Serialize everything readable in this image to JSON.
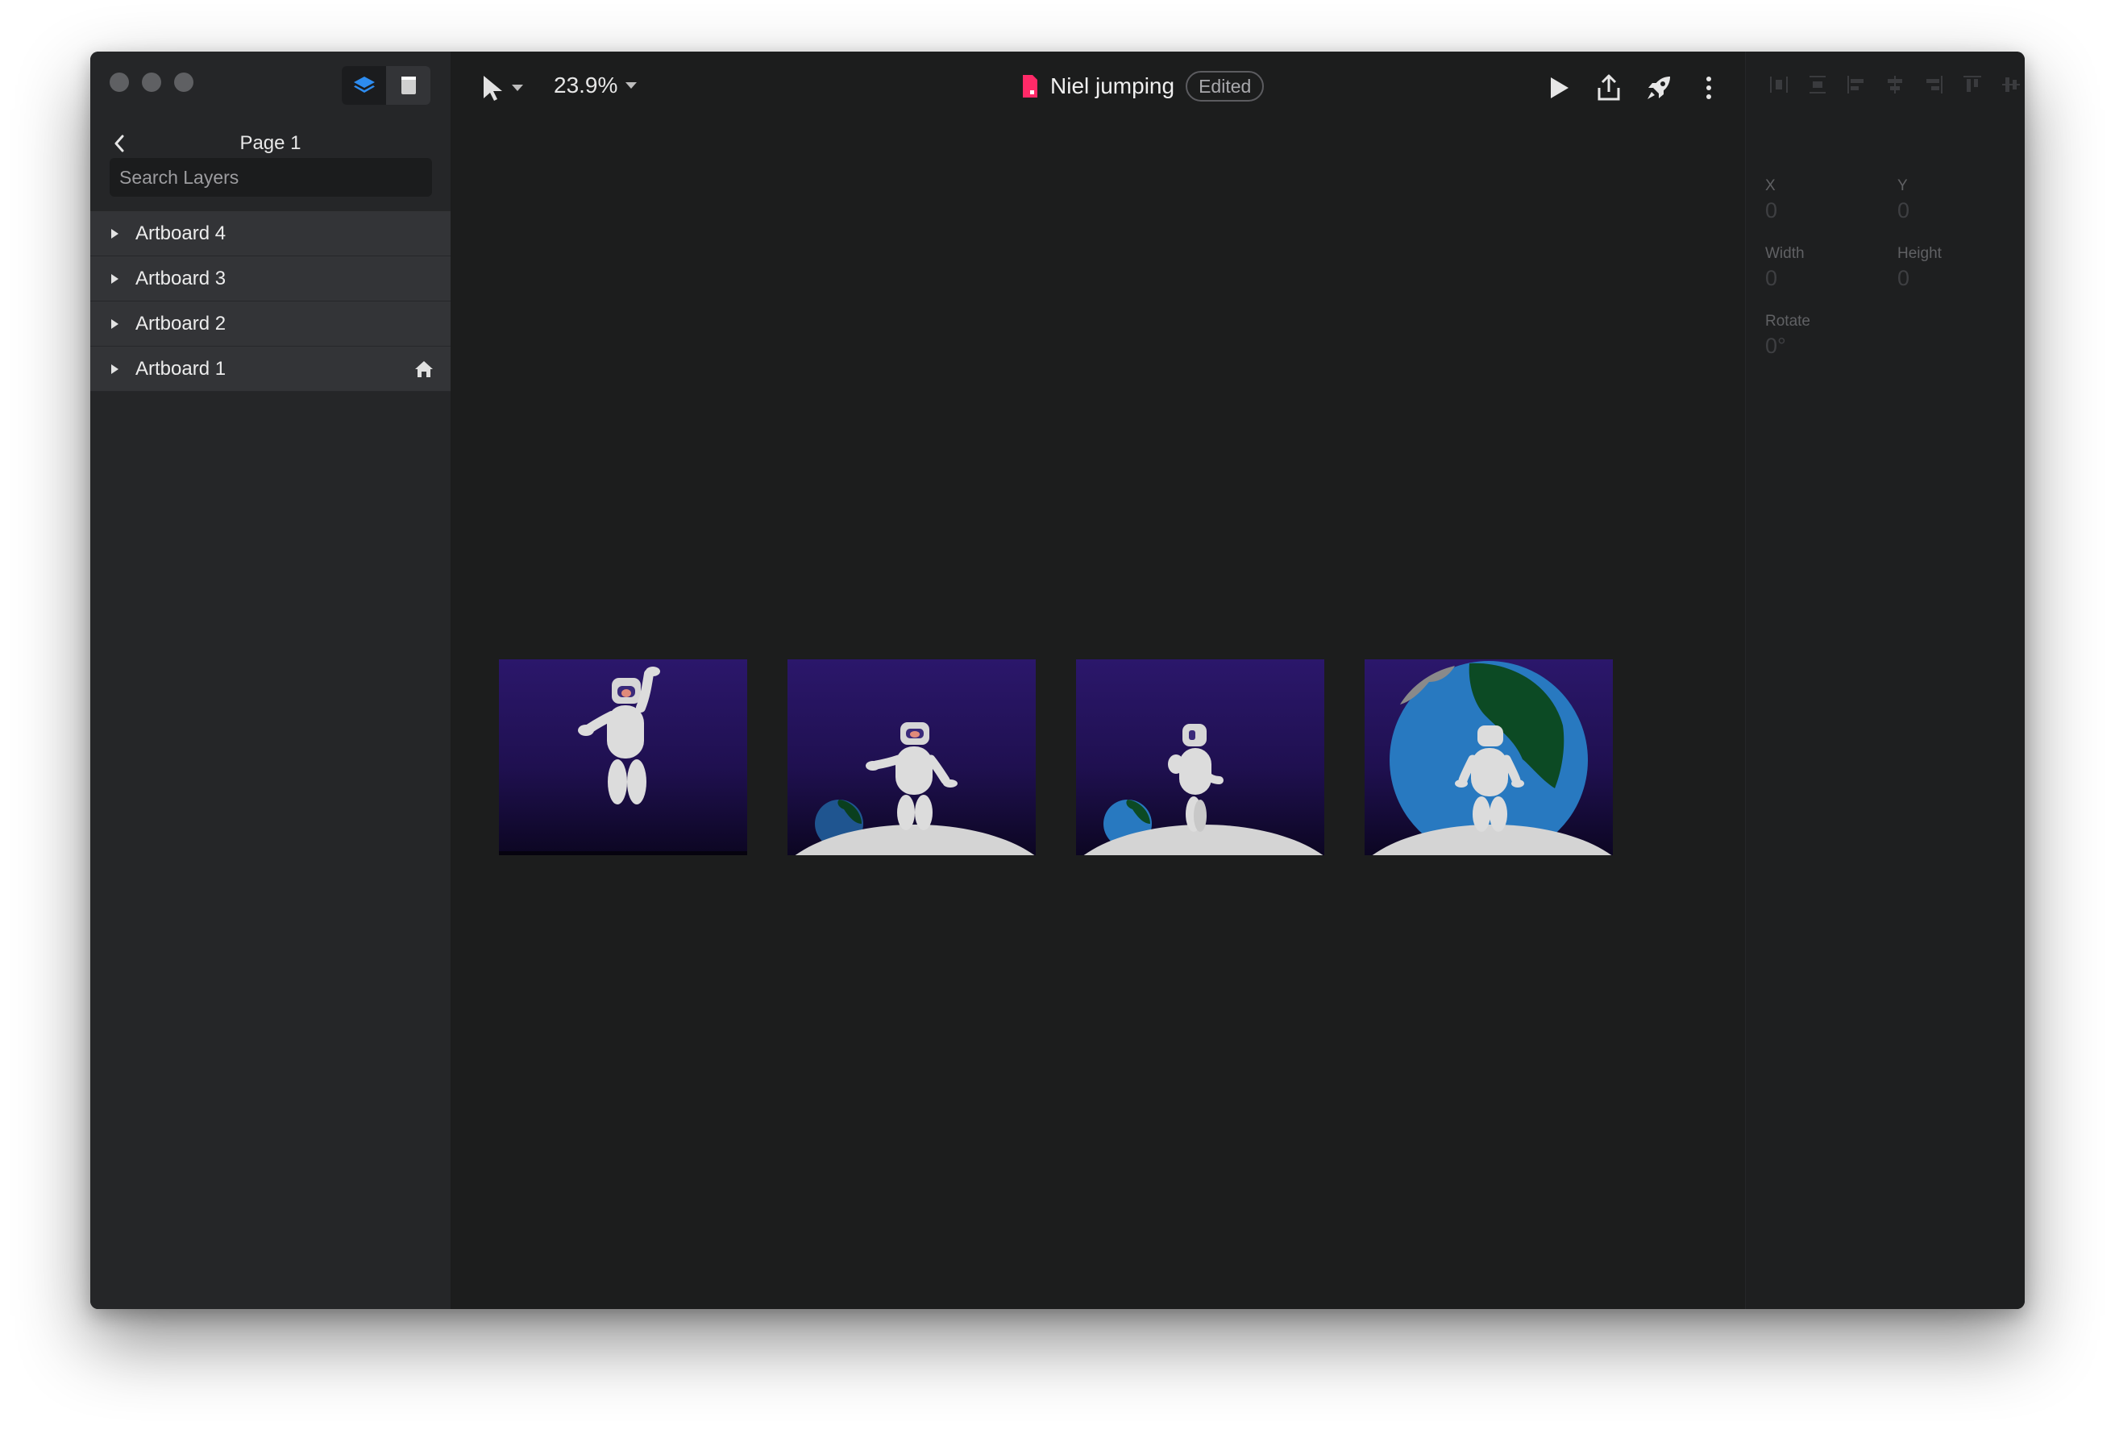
{
  "sidebar": {
    "page_title": "Page 1",
    "search_placeholder": "Search Layers",
    "layers": [
      {
        "label": "Artboard 4",
        "home": false
      },
      {
        "label": "Artboard 3",
        "home": false
      },
      {
        "label": "Artboard 2",
        "home": false
      },
      {
        "label": "Artboard 1",
        "home": true
      }
    ]
  },
  "toolbar": {
    "zoom": "23.9%",
    "document_title": "Niel jumping",
    "status_badge": "Edited",
    "tools": [
      "select-tool-icon",
      "play-icon",
      "share-icon",
      "publish-rocket-icon",
      "more-icon"
    ]
  },
  "properties": {
    "x_label": "X",
    "x_value": "0",
    "y_label": "Y",
    "y_value": "0",
    "width_label": "Width",
    "width_value": "0",
    "height_label": "Height",
    "height_value": "0",
    "rotate_label": "Rotate",
    "rotate_value": "0°"
  },
  "colors": {
    "accent": "#2d8cf0",
    "doc_icon": "#ff2a68",
    "artboard_sky_top": "#2b176b",
    "artboard_sky_bottom": "#0c0622",
    "earth_blue": "#2879c0",
    "earth_green": "#0c4a24",
    "moon": "#d4d4d4"
  }
}
